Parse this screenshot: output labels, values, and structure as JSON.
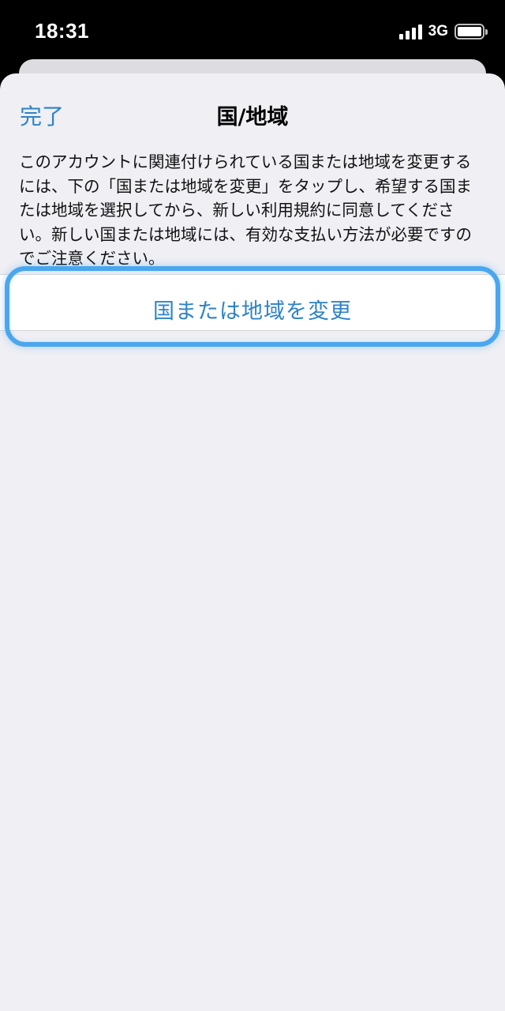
{
  "status_bar": {
    "time": "18:31",
    "network": "3G",
    "signal_icon": "signal-bars-icon",
    "battery_icon": "battery-icon"
  },
  "nav": {
    "done_label": "完了",
    "title": "国/地域"
  },
  "description": "このアカウントに関連付けられている国または地域を変更するには、下の「国または地域を変更」をタップし、希望する国または地域を選択してから、新しい利用規約に同意してください。新しい国または地域には、有効な支払い方法が必要ですのでご注意ください。",
  "change_button": {
    "label": "国または地域を変更"
  },
  "colors": {
    "accent": "#2e83c6",
    "highlight": "#4aa7ef",
    "sheet_background": "#efeff4"
  }
}
